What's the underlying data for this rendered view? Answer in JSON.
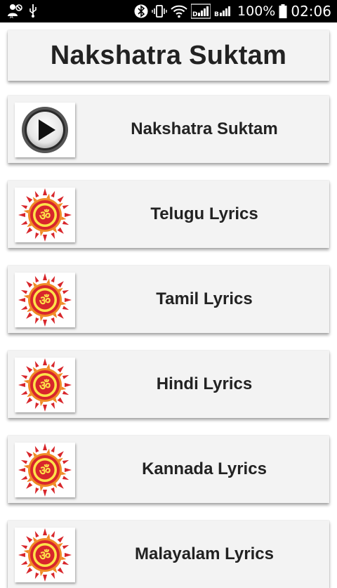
{
  "status_bar": {
    "battery_percent": "100%",
    "time": "02:06",
    "icons": [
      "person-off-icon",
      "usb-icon",
      "bluetooth-icon",
      "vibrate-icon",
      "wifi-icon",
      "signal-icon",
      "signal-icon",
      "battery-icon"
    ]
  },
  "title": "Nakshatra Suktam",
  "items": [
    {
      "label": "Nakshatra Suktam",
      "icon": "play-icon"
    },
    {
      "label": "Telugu Lyrics",
      "icon": "om-mandala-icon"
    },
    {
      "label": "Tamil Lyrics",
      "icon": "om-mandala-icon"
    },
    {
      "label": "Hindi Lyrics",
      "icon": "om-mandala-icon"
    },
    {
      "label": "Kannada Lyrics",
      "icon": "om-mandala-icon"
    },
    {
      "label": "Malayalam Lyrics",
      "icon": "om-mandala-icon"
    }
  ],
  "colors": {
    "card_bg": "#f3f3f3",
    "text": "#222222",
    "om_red": "#d8262b",
    "om_orange": "#f08a24",
    "om_yellow": "#fde34a"
  }
}
